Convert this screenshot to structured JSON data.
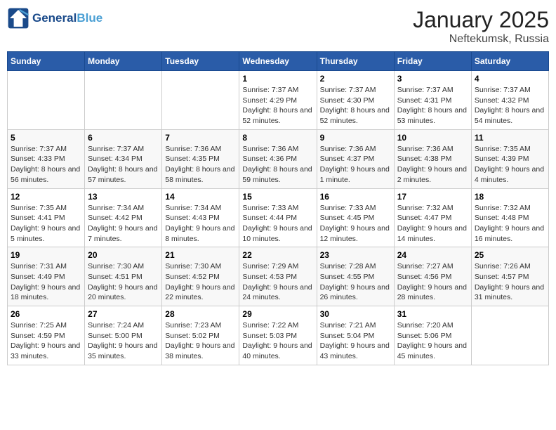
{
  "logo": {
    "line1": "General",
    "line2": "Blue"
  },
  "title": "January 2025",
  "subtitle": "Neftekumsk, Russia",
  "weekdays": [
    "Sunday",
    "Monday",
    "Tuesday",
    "Wednesday",
    "Thursday",
    "Friday",
    "Saturday"
  ],
  "weeks": [
    [
      {
        "day": "",
        "info": ""
      },
      {
        "day": "",
        "info": ""
      },
      {
        "day": "",
        "info": ""
      },
      {
        "day": "1",
        "info": "Sunrise: 7:37 AM\nSunset: 4:29 PM\nDaylight: 8 hours and 52 minutes."
      },
      {
        "day": "2",
        "info": "Sunrise: 7:37 AM\nSunset: 4:30 PM\nDaylight: 8 hours and 52 minutes."
      },
      {
        "day": "3",
        "info": "Sunrise: 7:37 AM\nSunset: 4:31 PM\nDaylight: 8 hours and 53 minutes."
      },
      {
        "day": "4",
        "info": "Sunrise: 7:37 AM\nSunset: 4:32 PM\nDaylight: 8 hours and 54 minutes."
      }
    ],
    [
      {
        "day": "5",
        "info": "Sunrise: 7:37 AM\nSunset: 4:33 PM\nDaylight: 8 hours and 56 minutes."
      },
      {
        "day": "6",
        "info": "Sunrise: 7:37 AM\nSunset: 4:34 PM\nDaylight: 8 hours and 57 minutes."
      },
      {
        "day": "7",
        "info": "Sunrise: 7:36 AM\nSunset: 4:35 PM\nDaylight: 8 hours and 58 minutes."
      },
      {
        "day": "8",
        "info": "Sunrise: 7:36 AM\nSunset: 4:36 PM\nDaylight: 8 hours and 59 minutes."
      },
      {
        "day": "9",
        "info": "Sunrise: 7:36 AM\nSunset: 4:37 PM\nDaylight: 9 hours and 1 minute."
      },
      {
        "day": "10",
        "info": "Sunrise: 7:36 AM\nSunset: 4:38 PM\nDaylight: 9 hours and 2 minutes."
      },
      {
        "day": "11",
        "info": "Sunrise: 7:35 AM\nSunset: 4:39 PM\nDaylight: 9 hours and 4 minutes."
      }
    ],
    [
      {
        "day": "12",
        "info": "Sunrise: 7:35 AM\nSunset: 4:41 PM\nDaylight: 9 hours and 5 minutes."
      },
      {
        "day": "13",
        "info": "Sunrise: 7:34 AM\nSunset: 4:42 PM\nDaylight: 9 hours and 7 minutes."
      },
      {
        "day": "14",
        "info": "Sunrise: 7:34 AM\nSunset: 4:43 PM\nDaylight: 9 hours and 8 minutes."
      },
      {
        "day": "15",
        "info": "Sunrise: 7:33 AM\nSunset: 4:44 PM\nDaylight: 9 hours and 10 minutes."
      },
      {
        "day": "16",
        "info": "Sunrise: 7:33 AM\nSunset: 4:45 PM\nDaylight: 9 hours and 12 minutes."
      },
      {
        "day": "17",
        "info": "Sunrise: 7:32 AM\nSunset: 4:47 PM\nDaylight: 9 hours and 14 minutes."
      },
      {
        "day": "18",
        "info": "Sunrise: 7:32 AM\nSunset: 4:48 PM\nDaylight: 9 hours and 16 minutes."
      }
    ],
    [
      {
        "day": "19",
        "info": "Sunrise: 7:31 AM\nSunset: 4:49 PM\nDaylight: 9 hours and 18 minutes."
      },
      {
        "day": "20",
        "info": "Sunrise: 7:30 AM\nSunset: 4:51 PM\nDaylight: 9 hours and 20 minutes."
      },
      {
        "day": "21",
        "info": "Sunrise: 7:30 AM\nSunset: 4:52 PM\nDaylight: 9 hours and 22 minutes."
      },
      {
        "day": "22",
        "info": "Sunrise: 7:29 AM\nSunset: 4:53 PM\nDaylight: 9 hours and 24 minutes."
      },
      {
        "day": "23",
        "info": "Sunrise: 7:28 AM\nSunset: 4:55 PM\nDaylight: 9 hours and 26 minutes."
      },
      {
        "day": "24",
        "info": "Sunrise: 7:27 AM\nSunset: 4:56 PM\nDaylight: 9 hours and 28 minutes."
      },
      {
        "day": "25",
        "info": "Sunrise: 7:26 AM\nSunset: 4:57 PM\nDaylight: 9 hours and 31 minutes."
      }
    ],
    [
      {
        "day": "26",
        "info": "Sunrise: 7:25 AM\nSunset: 4:59 PM\nDaylight: 9 hours and 33 minutes."
      },
      {
        "day": "27",
        "info": "Sunrise: 7:24 AM\nSunset: 5:00 PM\nDaylight: 9 hours and 35 minutes."
      },
      {
        "day": "28",
        "info": "Sunrise: 7:23 AM\nSunset: 5:02 PM\nDaylight: 9 hours and 38 minutes."
      },
      {
        "day": "29",
        "info": "Sunrise: 7:22 AM\nSunset: 5:03 PM\nDaylight: 9 hours and 40 minutes."
      },
      {
        "day": "30",
        "info": "Sunrise: 7:21 AM\nSunset: 5:04 PM\nDaylight: 9 hours and 43 minutes."
      },
      {
        "day": "31",
        "info": "Sunrise: 7:20 AM\nSunset: 5:06 PM\nDaylight: 9 hours and 45 minutes."
      },
      {
        "day": "",
        "info": ""
      }
    ]
  ]
}
